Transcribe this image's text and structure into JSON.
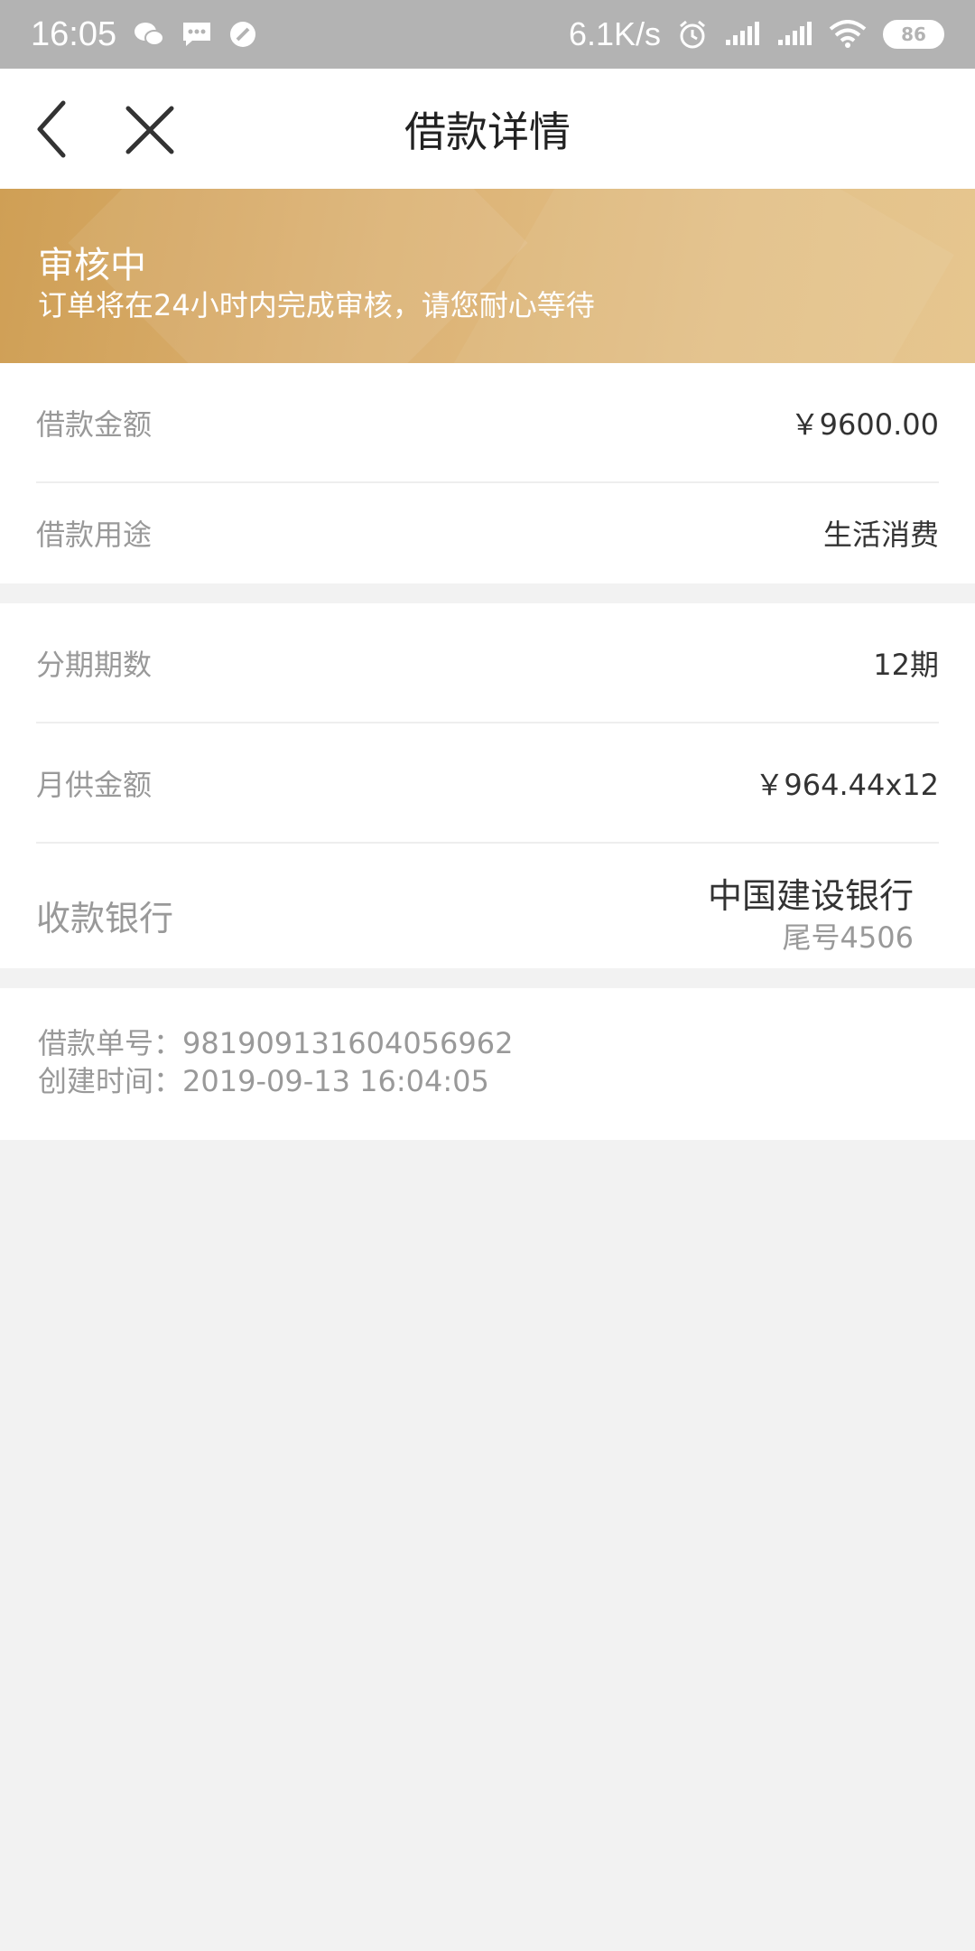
{
  "status_bar": {
    "time": "16:05",
    "net_speed": "6.1K/s",
    "battery": "86",
    "icons": [
      "wechat-icon",
      "message-icon",
      "blocked-icon",
      "alarm-icon",
      "signal-icon",
      "signal-icon",
      "wifi-icon",
      "battery-icon"
    ]
  },
  "nav": {
    "title": "借款详情",
    "back_icon": "chevron-left-icon",
    "close_icon": "close-icon"
  },
  "banner": {
    "title": "审核中",
    "subtitle": "订单将在24小时内完成审核，请您耐心等待"
  },
  "loan": {
    "amount_label": "借款金额",
    "amount_value": "￥9600.00",
    "purpose_label": "借款用途",
    "purpose_value": "生活消费"
  },
  "installment": {
    "periods_label": "分期期数",
    "periods_value": "12期",
    "monthly_label": "月供金额",
    "monthly_value": "￥964.44x12",
    "bank_label": "收款银行",
    "bank_name": "中国建设银行",
    "bank_tail": "尾号4506"
  },
  "order": {
    "number_line": "借款单号：981909131604056962",
    "created_line": "创建时间：2019-09-13 16:04:05"
  },
  "colors": {
    "banner_start": "#cf9f55",
    "banner_end": "#e6c68f",
    "status_bar": "#b3b3b3",
    "background": "#f2f2f2"
  }
}
